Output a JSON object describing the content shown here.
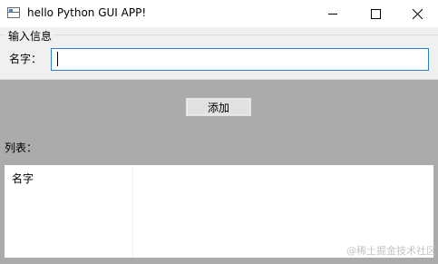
{
  "window": {
    "title": "hello Python GUI APP!",
    "controls": {
      "minimize_icon": "minimize-icon",
      "maximize_icon": "maximize-icon",
      "close_icon": "close-icon"
    }
  },
  "input_group": {
    "title": "输入信息",
    "name_label": "名字：",
    "name_value": "",
    "name_placeholder": ""
  },
  "actions": {
    "add_label": "添加"
  },
  "list": {
    "label": "列表：",
    "columns": [
      "名字"
    ]
  },
  "watermark": "@稀土掘金技术社区",
  "colors": {
    "background": "#ababab",
    "panel": "#f0f0f0",
    "input_border_focus": "#2f7fd0"
  }
}
